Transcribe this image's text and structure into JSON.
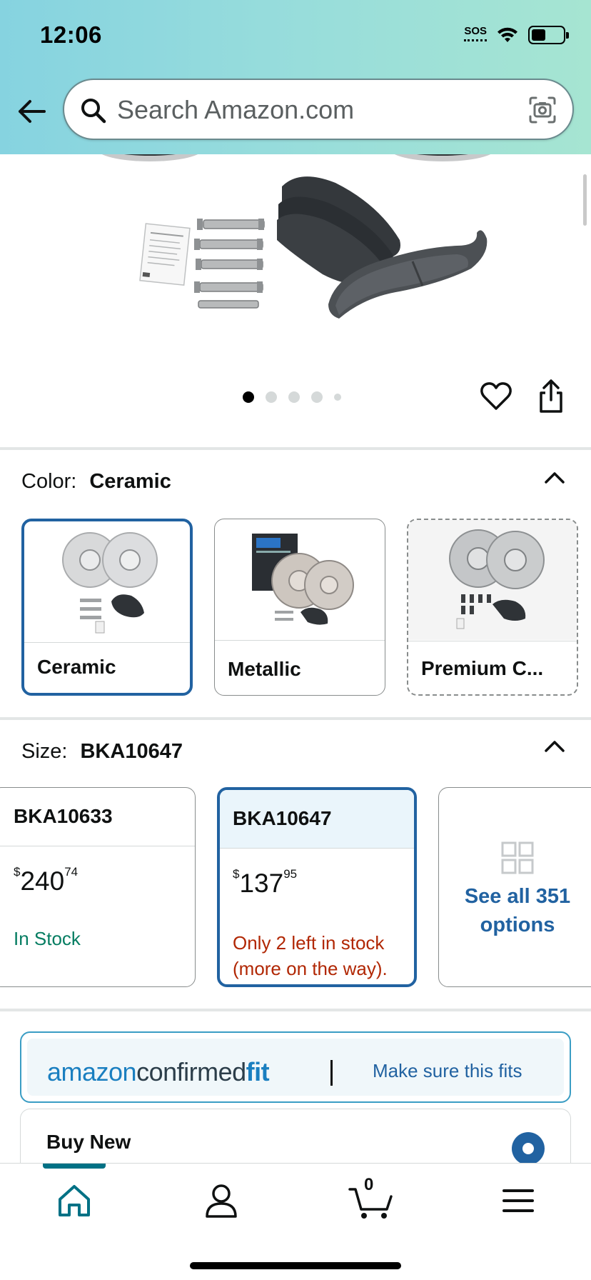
{
  "status_bar": {
    "time": "12:06",
    "sos": "SOS",
    "icons": [
      "wifi-icon",
      "battery-icon"
    ]
  },
  "search": {
    "placeholder": "Search Amazon.com",
    "value": ""
  },
  "gallery": {
    "image_count": 5,
    "active_index": 0
  },
  "color_section": {
    "label": "Color:",
    "selected": "Ceramic",
    "options": [
      {
        "label": "Ceramic",
        "selected": true
      },
      {
        "label": "Metallic",
        "selected": false
      },
      {
        "label": "Premium C...",
        "selected": false
      }
    ]
  },
  "size_section": {
    "label": "Size:",
    "selected": "BKA10647",
    "options": [
      {
        "name": "BKA10633",
        "price_symbol": "$",
        "price_whole": "240",
        "price_fraction": "74",
        "stock": "In Stock"
      },
      {
        "name": "BKA10647",
        "price_symbol": "$",
        "price_whole": "137",
        "price_fraction": "95",
        "stock": "Only 2 left in stock (more on the way).",
        "selected": true
      }
    ],
    "see_all": "See all 351 options"
  },
  "confirmed_fit": {
    "logo_amazon": "amazon",
    "logo_confirmed": "confirmed",
    "logo_fit": "fit",
    "link": "Make sure this fits"
  },
  "buy_box": {
    "title": "Buy New"
  },
  "bottom_nav": {
    "cart_count": "0",
    "items": [
      "home-icon",
      "account-icon",
      "cart-icon",
      "menu-icon"
    ]
  },
  "colors": {
    "accent_blue": "#2162a1",
    "teal": "#007185",
    "stock_green": "#067d62",
    "stock_red": "#b12704"
  }
}
